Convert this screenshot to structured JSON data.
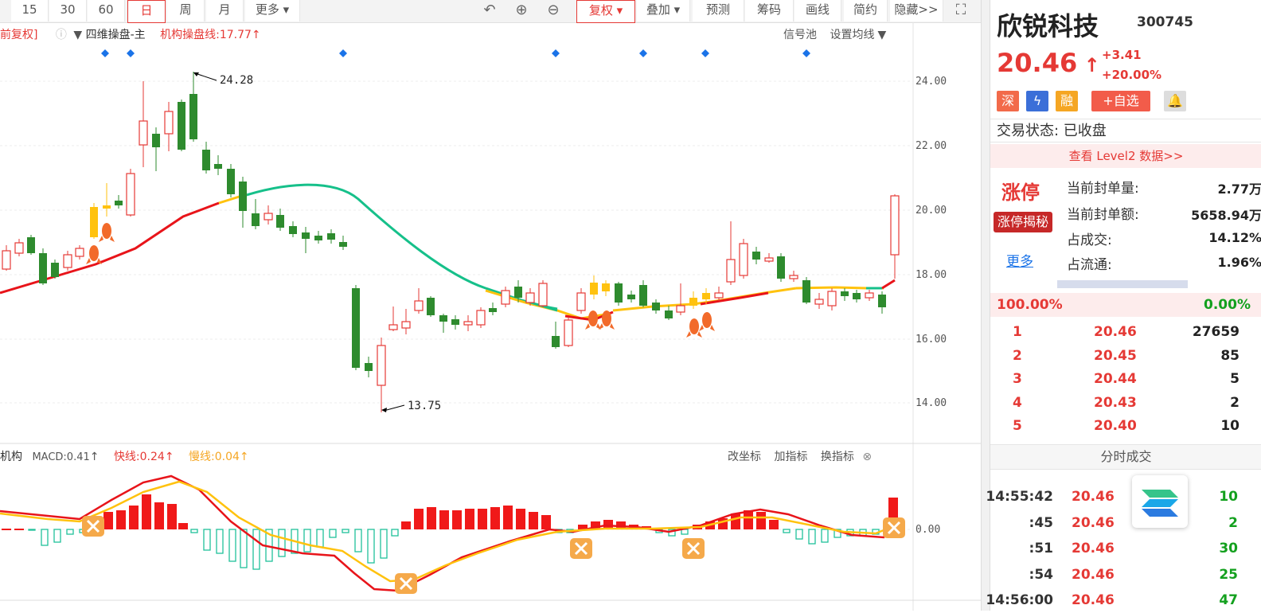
{
  "toolbar": {
    "periods": [
      "15",
      "30",
      "60",
      "日",
      "周",
      "月",
      "更多"
    ],
    "active_period": "日",
    "actions": [
      "复权",
      "叠加",
      "预测",
      "筹码",
      "画线",
      "简约",
      "隐藏>>"
    ]
  },
  "legend": {
    "fq_label": "前复权]",
    "indicator_label": "四维操盘-主",
    "line_label": "机构操盘线:17.77",
    "signal_pool": "信号池",
    "ma_settings": "设置均线"
  },
  "price_axis": [
    "24.00",
    "22.00",
    "20.00",
    "18.00",
    "16.00",
    "14.00"
  ],
  "macd_axis": "0.00",
  "annotations": {
    "high": "24.28",
    "low": "13.75"
  },
  "macd_legend": {
    "prefix": "机构",
    "macd": "MACD:0.41",
    "fast": "快线:0.24",
    "slow": "慢线:0.04",
    "actions": [
      "改坐标",
      "加指标",
      "换指标"
    ]
  },
  "stock": {
    "name": "欣锐科技",
    "code": "300745",
    "price": "20.46",
    "change": "+3.41",
    "change_pct": "+20.00%"
  },
  "badges": [
    "深",
    "融",
    "+自选"
  ],
  "trade_status": "交易状态: 已收盘",
  "level2_link": "查看 Level2 数据>>",
  "limit": {
    "label": "涨停",
    "secret_button": "涨停揭秘",
    "more_link": "更多",
    "rows": [
      {
        "k": "当前封单量:",
        "v": "2.77万"
      },
      {
        "k": "当前封单额:",
        "v": "5658.94万"
      },
      {
        "k": "占成交:",
        "v": "14.12%"
      },
      {
        "k": "占流通:",
        "v": "1.96%"
      }
    ]
  },
  "ratio": {
    "buy": "100.00%",
    "sell": "0.00%"
  },
  "order_book": [
    {
      "level": "1",
      "price": "20.46",
      "vol": "27659"
    },
    {
      "level": "2",
      "price": "20.45",
      "vol": "85"
    },
    {
      "level": "3",
      "price": "20.44",
      "vol": "5"
    },
    {
      "level": "4",
      "price": "20.43",
      "vol": "2"
    },
    {
      "level": "5",
      "price": "20.40",
      "vol": "10"
    }
  ],
  "fenshi_title": "分时成交",
  "trades": [
    {
      "time": "14:55:42",
      "price": "20.46",
      "vol": "10"
    },
    {
      "time": ":45",
      "price": "20.46",
      "vol": "2"
    },
    {
      "time": ":51",
      "price": "20.46",
      "vol": "30"
    },
    {
      "time": ":54",
      "price": "20.46",
      "vol": "25"
    },
    {
      "time": "14:56:00",
      "price": "20.46",
      "vol": "47"
    }
  ],
  "colors": {
    "up": "#e53935",
    "down": "#2e8b2e",
    "accent": "#e53935"
  }
}
